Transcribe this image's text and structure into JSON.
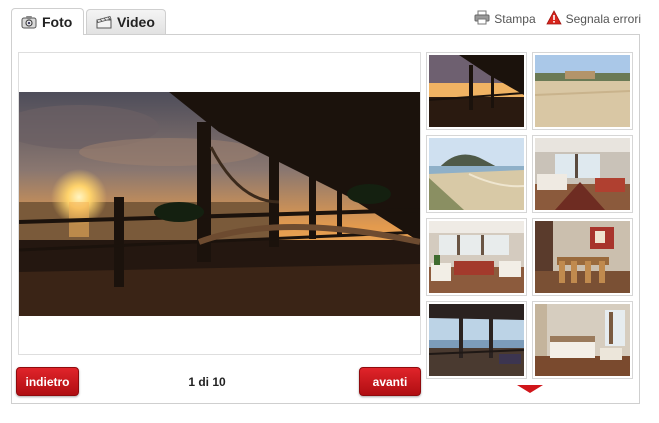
{
  "tabs": [
    {
      "label": "Foto",
      "icon": "camera-icon",
      "active": true
    },
    {
      "label": "Video",
      "icon": "clapperboard-icon",
      "active": false
    }
  ],
  "actions": {
    "print_label": "Stampa",
    "print_icon": "printer-icon",
    "report_label": "Segnala errori",
    "report_icon": "warning-icon"
  },
  "gallery": {
    "main_image": "sunset-terrace-hammock-photo",
    "back_label": "indietro",
    "next_label": "avanti",
    "counter": "1 di 10",
    "thumbnails": [
      "sunset-terrace-thumb",
      "beach-house-dunes-thumb",
      "beach-headland-thumb",
      "living-room-windows-thumb",
      "living-room-sofas-thumb",
      "dining-room-thumb",
      "terrace-sea-view-thumb",
      "bedroom-thumb"
    ]
  },
  "colors": {
    "button_red": "#c8161b",
    "border": "#cfcfcf"
  }
}
